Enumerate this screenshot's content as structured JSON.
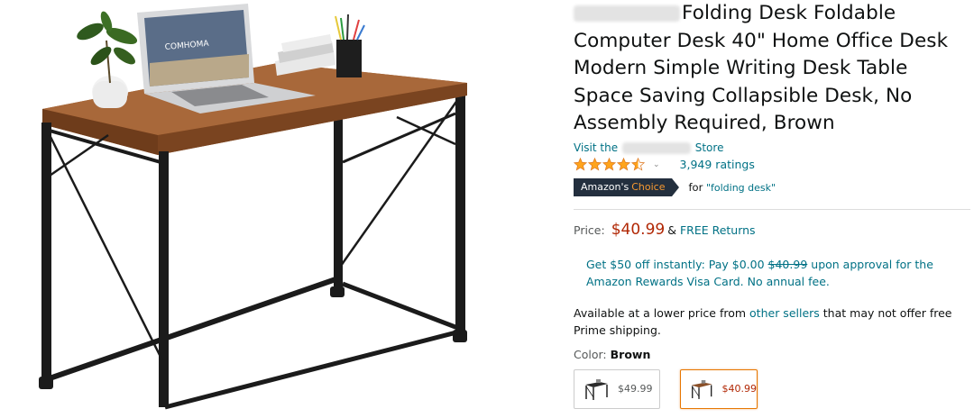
{
  "product": {
    "title": "Folding Desk Foldable Computer Desk 40\" Home Office Desk Modern Simple Writing Desk Table Space Saving Collapsible Desk, No Assembly Required, Brown",
    "store_prefix": "Visit the",
    "store_suffix": "Store",
    "rating_stars": 4.5,
    "ratings_count": "3,949 ratings",
    "badge_main": "Amazon's",
    "badge_accent": "Choice",
    "badge_for": "for",
    "badge_query": "\"folding desk\"",
    "price_label": "Price:",
    "price": "$40.99",
    "free_amp": "&",
    "free_returns": "FREE Returns",
    "promo_pre": "Get $50 off instantly: Pay $0.00",
    "promo_strike": "$40.99",
    "promo_post": "upon approval for the Amazon Rewards Visa Card. No annual fee.",
    "avail_pre": "Available at a lower price from",
    "avail_link": "other sellers",
    "avail_post": "that may not offer free Prime shipping.",
    "color_label": "Color:",
    "color_value": "Brown",
    "swatches": [
      {
        "price": "$49.99",
        "selected": false
      },
      {
        "price": "$40.99",
        "selected": true
      }
    ],
    "laptop_text": "COMHOMA"
  },
  "colors": {
    "link": "#007185",
    "price": "#b12704",
    "badge_bg": "#232f3e",
    "badge_accent": "#f69931",
    "star": "#ffa41c",
    "wood": "#9a5b2e"
  }
}
